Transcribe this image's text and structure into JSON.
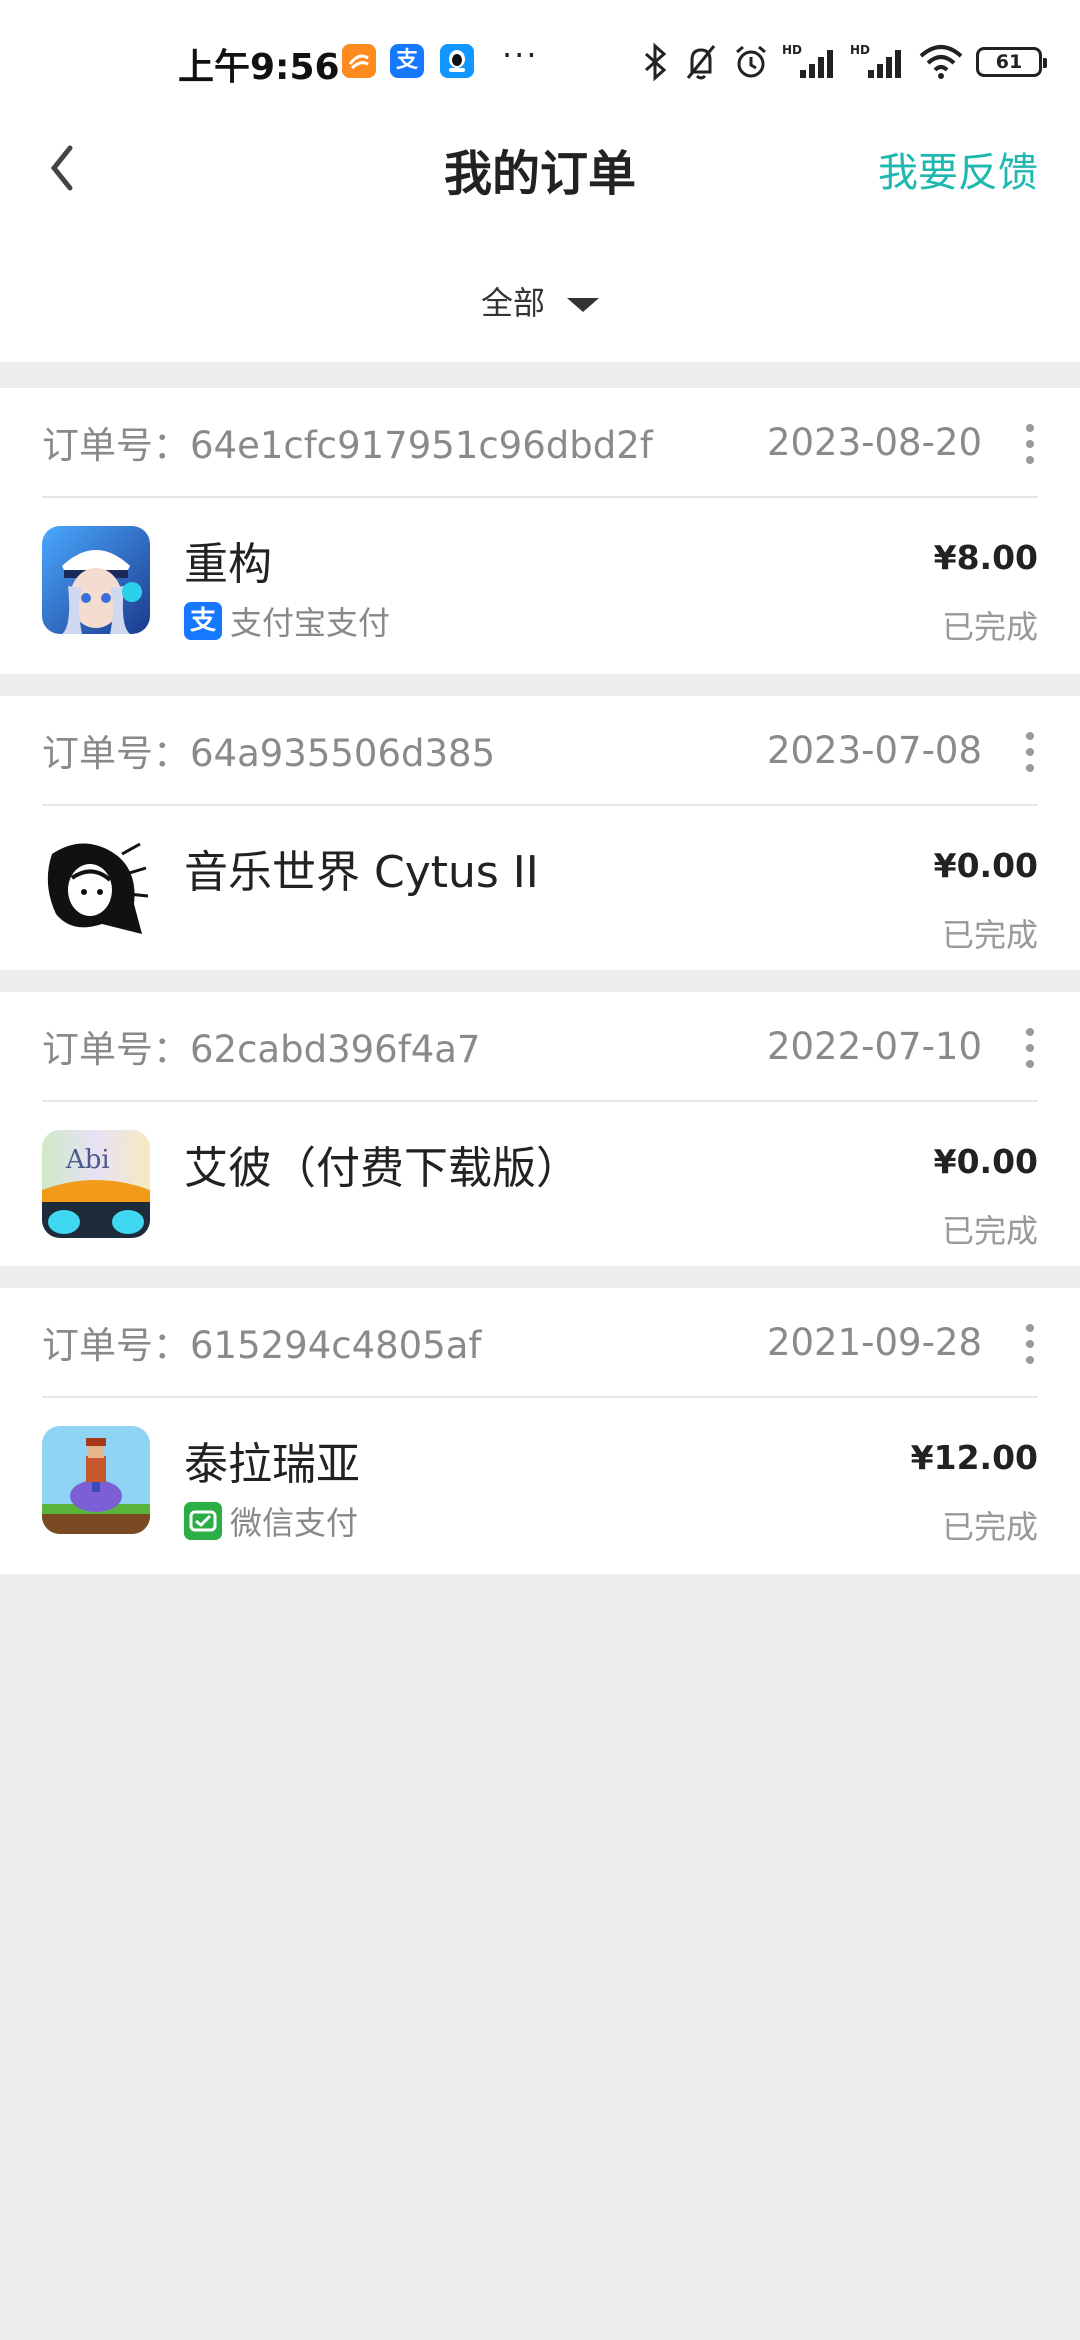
{
  "status_bar": {
    "time": "上午9:56",
    "alipay_glyph": "支",
    "more": "···",
    "battery": "61",
    "network_labels": [
      "HD",
      "HD"
    ],
    "icons": [
      "taobao-icon",
      "alipay-icon",
      "qq-icon",
      "bluetooth-icon",
      "mute-icon",
      "alarm-icon",
      "signal-icon",
      "signal-icon",
      "wifi-icon",
      "battery-icon"
    ]
  },
  "nav": {
    "back_icon": "chevron-left-icon",
    "title": "我的订单",
    "feedback": "我要反馈"
  },
  "filter": {
    "label": "全部",
    "icon": "caret-down-icon"
  },
  "colors": {
    "accent": "#1fb8b0",
    "alipay": "#1677ff",
    "wechat": "#2bae45",
    "background": "#ececec"
  },
  "orders": [
    {
      "order_no": "订单号：64e1cfc917951c96dbd2f",
      "date": "2023-08-20",
      "app_name": "重构",
      "payment": "支付宝支付",
      "payment_icon": "alipay-icon",
      "payment_glyph": "支",
      "price": "¥8.00",
      "status": "已完成"
    },
    {
      "order_no": "订单号：64a935506d385",
      "date": "2023-07-08",
      "app_name": "音乐世界 Cytus II",
      "price": "¥0.00",
      "status": "已完成"
    },
    {
      "order_no": "订单号：62cabd396f4a7",
      "date": "2022-07-10",
      "app_name": "艾彼（付费下载版）",
      "icon_text": "Abi",
      "price": "¥0.00",
      "status": "已完成"
    },
    {
      "order_no": "订单号：615294c4805af",
      "date": "2021-09-28",
      "app_name": "泰拉瑞亚",
      "payment": "微信支付",
      "payment_icon": "wechat-pay-icon",
      "price": "¥12.00",
      "status": "已完成"
    }
  ]
}
